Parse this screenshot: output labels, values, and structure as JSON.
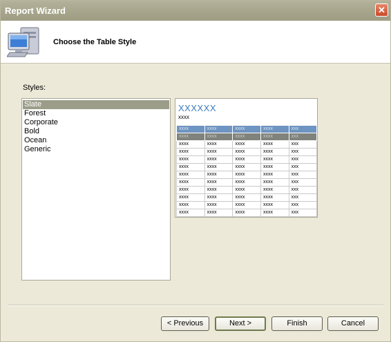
{
  "window": {
    "title": "Report Wizard",
    "close_glyph": "✕"
  },
  "header": {
    "title": "Choose the Table Style",
    "icon": "computer-icon"
  },
  "styles": {
    "label": "Styles:",
    "items": [
      "Slate",
      "Forest",
      "Corporate",
      "Bold",
      "Ocean",
      "Generic"
    ],
    "selected": "Slate"
  },
  "preview": {
    "title": "XXXXXX",
    "subtitle": "xxxx",
    "header_cells": [
      "xxxx",
      "xxxx",
      "xxxx",
      "xxxx",
      "xxx"
    ],
    "group_cells": [
      "xxxx",
      "xxxx",
      "xxxx",
      "xxxx",
      "xxx"
    ],
    "row_cells": [
      "xxxx",
      "xxxx",
      "xxxx",
      "xxxx",
      "xxx"
    ],
    "row_count": 10,
    "colors": {
      "title": "#3b7bb9",
      "header_row": "#6e94c1",
      "group_row": "#80827c"
    }
  },
  "buttons": {
    "previous": "< Previous",
    "next": "Next >",
    "finish": "Finish",
    "cancel": "Cancel"
  }
}
